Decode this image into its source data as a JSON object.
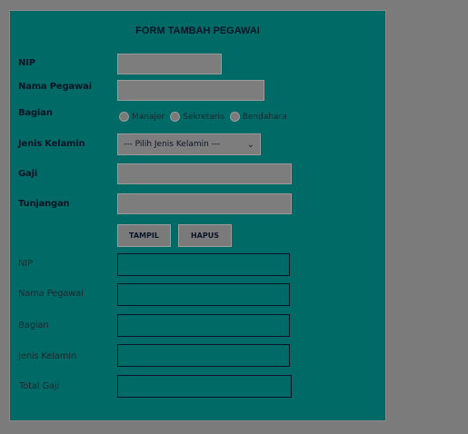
{
  "form": {
    "title": "FORM TAMBAH PEGAWAI",
    "labels": {
      "nip": "NIP",
      "nama": "Nama Pegawai",
      "bagian": "Bagian",
      "jenis_kelamin": "Jenis Kelamin",
      "gaji": "Gaji",
      "tunjangan": "Tunjangan"
    },
    "inputs": {
      "nip": "",
      "nama": "",
      "gaji": "",
      "tunjangan": ""
    },
    "bagian_options": [
      "Manajer",
      "Sekretaris",
      "Bendahara"
    ],
    "jenis_kelamin_select": {
      "selected": "--- Pilih Jenis Kelamin ---"
    },
    "buttons": {
      "tampil": "TAMPIL",
      "hapus": "HAPUS"
    }
  },
  "output": {
    "labels": {
      "nip": "NIP",
      "nama": "Nama Pegawai",
      "bagian": "Bagian",
      "jenis_kelamin": "Jenis Kelamin",
      "total_gaji": "Total Gaji"
    },
    "values": {
      "nip": "",
      "nama": "",
      "bagian": "",
      "jenis_kelamin": "",
      "total_gaji": ""
    }
  },
  "colors": {
    "panel": "#006b66",
    "background": "#7b7b7b",
    "text": "#0b1426"
  }
}
